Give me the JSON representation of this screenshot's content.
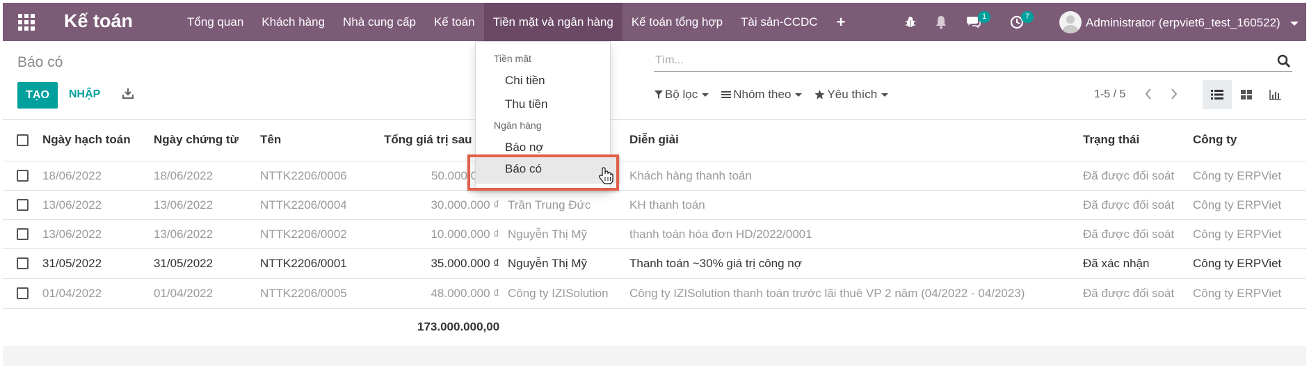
{
  "app": {
    "brand": "Kế toán",
    "menu": [
      "Tổng quan",
      "Khách hàng",
      "Nhà cung cấp",
      "Kế toán",
      "Tiền mặt và ngân hàng",
      "Kế toán tổng hợp",
      "Tài sản-CCDC"
    ],
    "menu_plus": "+",
    "active_menu": "Tiền mặt và ngân hàng",
    "messages_count": "1",
    "activities_count": "7",
    "user": "Administrator (erpviet6_test_160522)",
    "accent_color": "#7c5b77",
    "primary_color": "#00a09d"
  },
  "control": {
    "breadcrumb": "Báo có",
    "search_placeholder": "Tìm...",
    "create_label": "TẠO",
    "import_label": "NHẬP",
    "filter_label": "Bộ lọc",
    "groupby_label": "Nhóm theo",
    "favorites_label": "Yêu thích",
    "pager": "1-5 / 5"
  },
  "table": {
    "headers": [
      "Ngày hạch toán",
      "Ngày chứng từ",
      "Tên",
      "Tổng giá trị sau th",
      "Diễn giải",
      "Trạng thái",
      "Công ty"
    ],
    "rows": [
      {
        "date_acc": "18/06/2022",
        "date_doc": "18/06/2022",
        "name": "NTTK2206/0006",
        "amount": "50.000.0",
        "partner": "",
        "desc": "Khách hàng thanh toán",
        "state": "Đã được đối soát",
        "company": "Công ty ERPViet"
      },
      {
        "date_acc": "13/06/2022",
        "date_doc": "13/06/2022",
        "name": "NTTK2206/0004",
        "amount": "30.000.000 ₫",
        "partner": "Trần Trung Đức",
        "desc": "KH thanh toán",
        "state": "Đã được đối soát",
        "company": "Công ty ERPViet"
      },
      {
        "date_acc": "13/06/2022",
        "date_doc": "13/06/2022",
        "name": "NTTK2206/0002",
        "amount": "10.000.000 ₫",
        "partner": "Nguyễn Thị Mỹ",
        "desc": "thanh toán hóa đơn HD/2022/0001",
        "state": "Đã được đối soát",
        "company": "Công ty ERPViet"
      },
      {
        "date_acc": "31/05/2022",
        "date_doc": "31/05/2022",
        "name": "NTTK2206/0001",
        "amount": "35.000.000 ₫",
        "partner": "Nguyễn Thị Mỹ",
        "desc": "Thanh toán ~30% giá trị công nợ",
        "state": "Đã xác nhận",
        "company": "Công ty ERPViet"
      },
      {
        "date_acc": "01/04/2022",
        "date_doc": "01/04/2022",
        "name": "NTTK2206/0005",
        "amount": "48.000.000 ₫",
        "partner": "Công ty IZISolution",
        "desc": "Công ty IZISolution thanh toán trước lãi thuê VP 2 năm (04/2022 - 04/2023)",
        "state": "Đã được đối soát",
        "company": "Công ty ERPViet"
      }
    ],
    "total": "173.000.000,00"
  },
  "dropdown": {
    "section_cash": "Tiền mặt",
    "cash_items": [
      "Chi tiền",
      "Thu tiền"
    ],
    "section_bank": "Ngân hàng",
    "bank_items": [
      "Báo nợ",
      "Báo có"
    ],
    "hovered_item": "Báo có"
  }
}
